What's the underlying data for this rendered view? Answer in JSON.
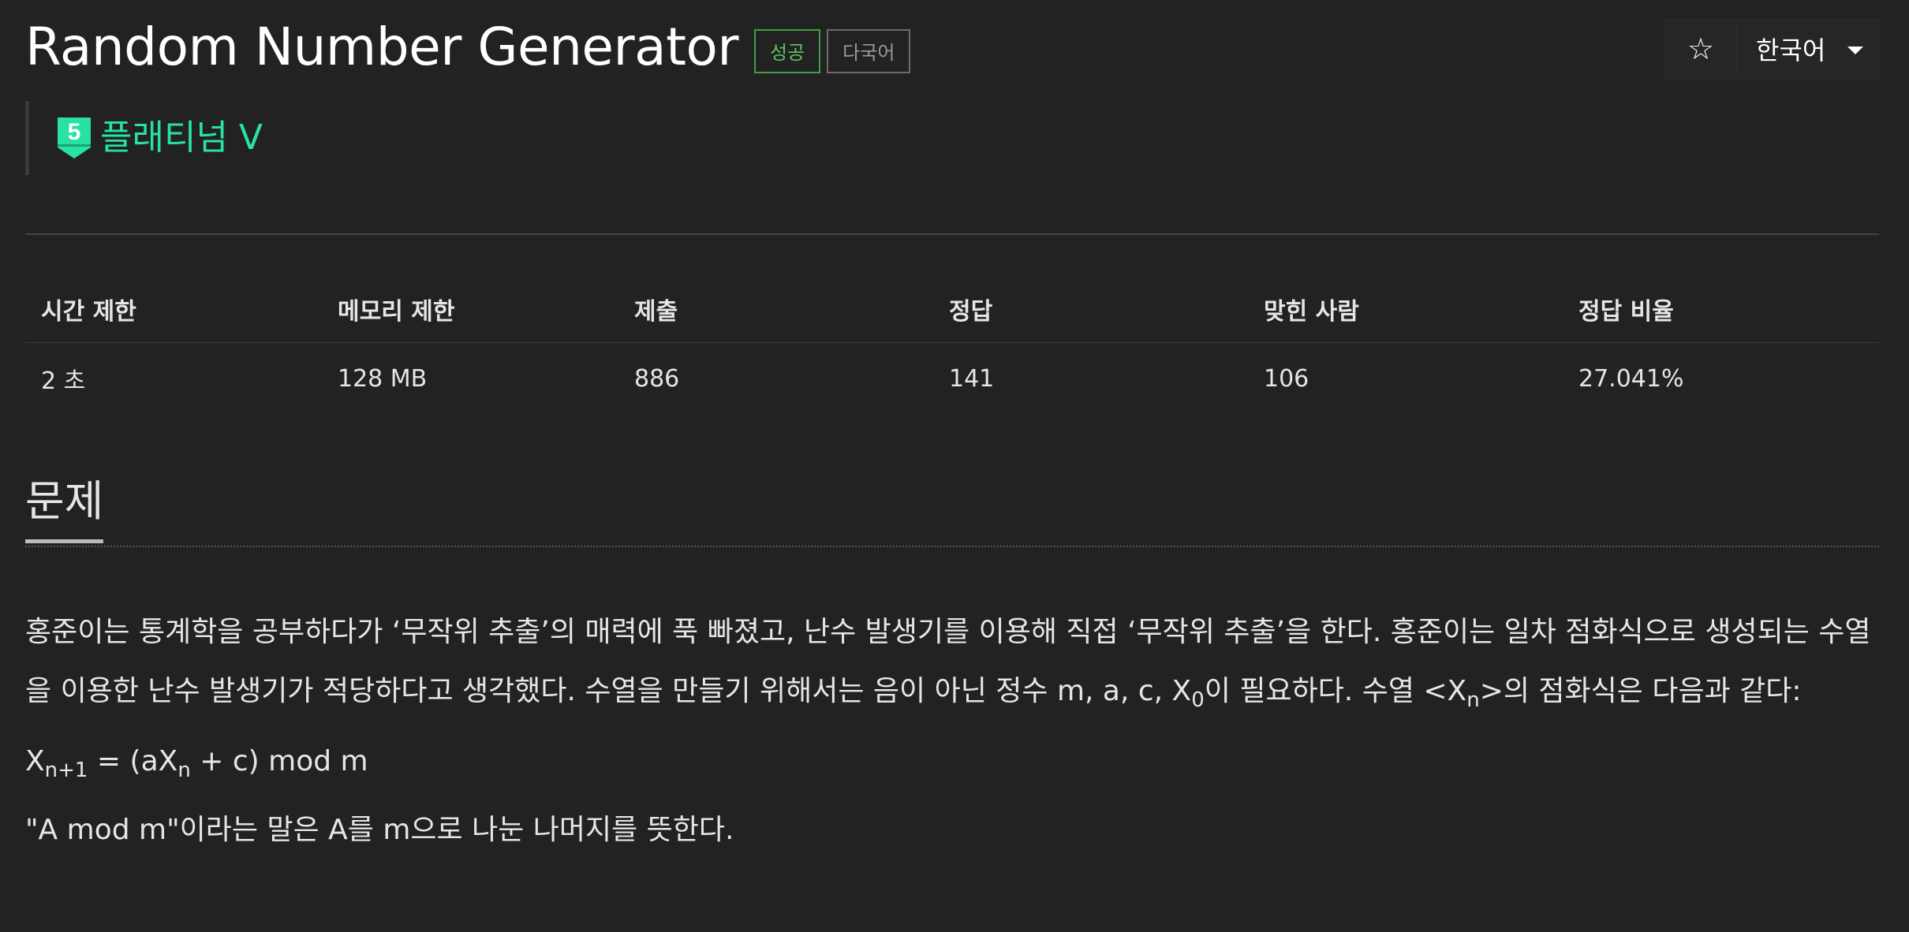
{
  "header": {
    "title": "Random Number Generator",
    "badge_success": "성공",
    "badge_multilang": "다국어",
    "favorite_icon": "star-icon",
    "language_label": "한국어"
  },
  "tier": {
    "level": "5",
    "label": "플래티넘 V",
    "color": "#27e2a4"
  },
  "info_table": {
    "headers": [
      "시간 제한",
      "메모리 제한",
      "제출",
      "정답",
      "맞힌 사람",
      "정답 비율"
    ],
    "values": [
      "2 초",
      "128 MB",
      "886",
      "141",
      "106",
      "27.041%"
    ]
  },
  "problem": {
    "section_title": "문제",
    "p1_a": "홍준이는 통계학을 공부하다가 ‘무작위 추출’의 매력에 푹 빠졌고, 난수 발생기를 이용해 직접 ‘무작위 추출’을 한다. 홍준이는 일차 점화식으로 생성되는 수열을 이용한 난수 발생기가 적당하다고 생각했다. 수열을 만들기 위해서는 음이 아닌 정수 m, a, c, X",
    "p1_sub1": "0",
    "p1_b": "이 필요하다. 수열 <X",
    "p1_sub2": "n",
    "p1_c": ">의 점화식은 다음과 같다:",
    "f_a": "X",
    "f_sub1": "n+1",
    "f_b": " = (aX",
    "f_sub2": "n",
    "f_c": " + c) mod m",
    "p3": "\"A mod m\"이라는 말은 A를 m으로 나눈 나머지를 뜻한다."
  }
}
